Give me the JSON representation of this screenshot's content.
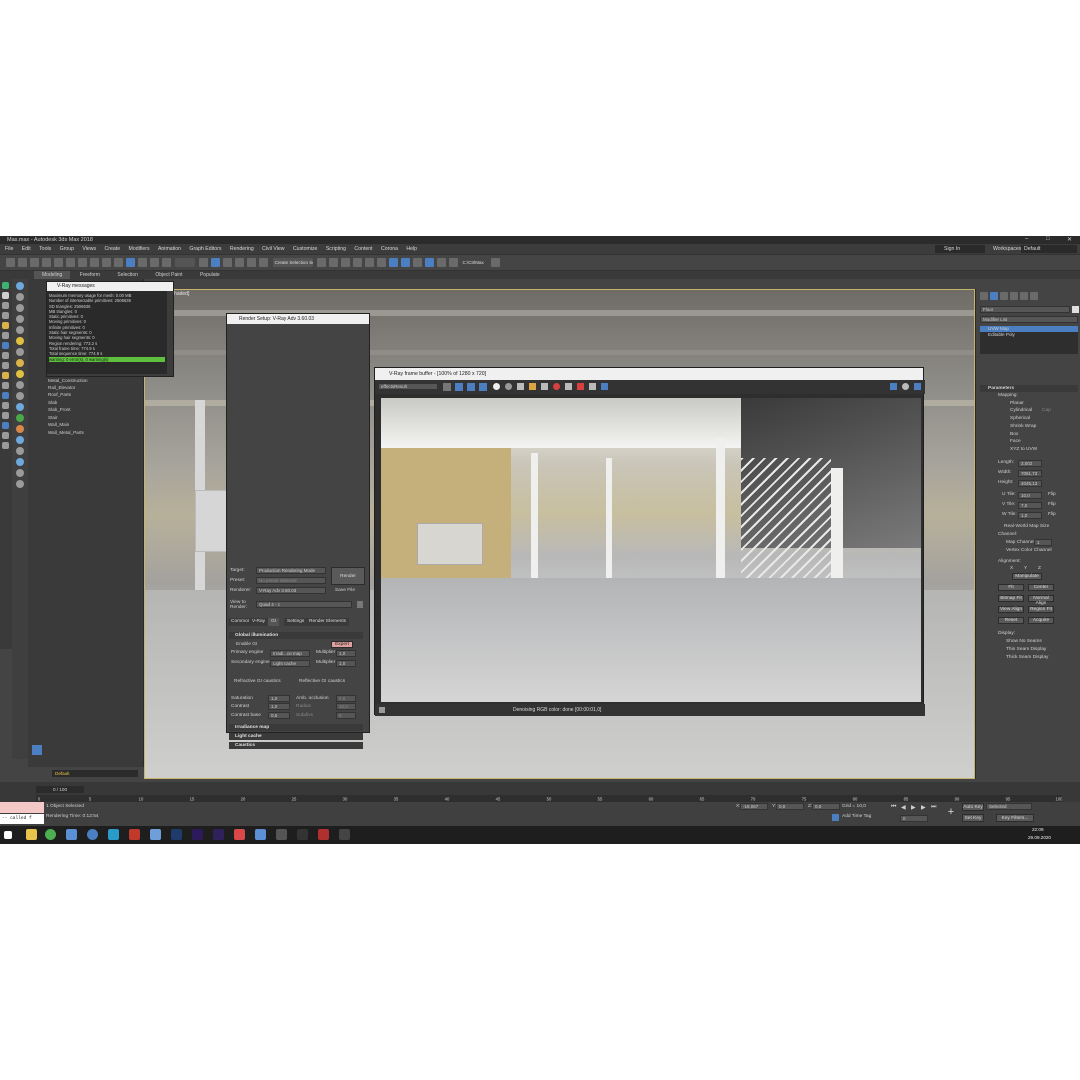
{
  "window": {
    "title": "Mas.max - Autodesk 3ds Max 2018"
  },
  "menu": [
    "File",
    "Edit",
    "Tools",
    "Group",
    "Views",
    "Create",
    "Modifiers",
    "Animation",
    "Graph Editors",
    "Rendering",
    "Civil View",
    "Customize",
    "Scripting",
    "Content",
    "Corona",
    "Help"
  ],
  "header": {
    "sign_in": "Sign In",
    "workspaces_label": "Workspaces:",
    "workspace": "Default",
    "selection_set": "Create Selection Se",
    "view_dropdown": "View",
    "ctrl_label": "C:\\CtrlMax"
  },
  "ribbon_tabs": [
    "Modeling",
    "Freeform",
    "Selection",
    "Object Paint",
    "Populate"
  ],
  "viewport": {
    "label": "[+] [Top] [Shaded]"
  },
  "vray_messages": {
    "title": "V-Ray messages",
    "lines": [
      "Maximum memory usage for mesh: 0.00 MB",
      "Number of intersectable primitives: 2506636",
      "SD triangles: 2506636",
      "MB triangles: 0",
      "Static primitives: 0",
      "Moving primitives: 0",
      "Infinite primitives: 0",
      "Static hair segments: 0",
      "Moving hair segments: 0",
      "Region rendering: 773.2 s",
      "Total frame time: 774.9 s",
      "Total sequence time: 774.9 s"
    ],
    "highlight": "warning: 0 error(s), 0 warning(s)"
  },
  "scene_explorer": {
    "items": [
      "Metal_Construction",
      "Rail_Elevator",
      "Roof_Parts",
      "Slab",
      "Slab_Front",
      "Stair",
      "Wall_Main",
      "Wall_Metal_Parts"
    ],
    "layer": "Default"
  },
  "render_setup": {
    "title": "Render Setup: V-Ray Adv 3.60.03",
    "target_label": "Target:",
    "target": "Production Rendering Mode",
    "preset_label": "Preset:",
    "preset": "No preset selected",
    "renderer_label": "Renderer:",
    "renderer": "V-Ray Adv 3.60.03",
    "save_file": "Save File",
    "view_label": "View to Render:",
    "view": "Quad 4 - c",
    "render_button": "Render",
    "tabs": [
      "Common",
      "V-Ray",
      "GI",
      "Settings",
      "Render Elements"
    ],
    "gi_section": "Global illumination",
    "enable_gi": "Enable GI",
    "expert": "Expert",
    "primary_label": "Primary engine",
    "primary": "Irradi...ce map",
    "secondary_label": "Secondary engine",
    "secondary": "Light cache",
    "multiplier_label": "Multiplier",
    "multiplier1": "1,0",
    "multiplier2": "1,0",
    "refractive": "Refractive GI caustics",
    "reflective": "Reflective GI caustics",
    "saturation_label": "Saturation",
    "saturation": "1,0",
    "contrast_label": "Contrast",
    "contrast": "1,0",
    "contrast_base_label": "Contrast base",
    "contrast_base": "0,5",
    "amb_occ": "Amb. occlusion",
    "amb_val": "0,8",
    "radius_label": "Radius",
    "radius_val": "10,0",
    "subdivs_label": "Subdivs",
    "subdivs_val": "8",
    "irradiance": "Irradiance map",
    "light_cache": "Light cache",
    "caustics": "Caustics"
  },
  "frame_buffer": {
    "title": "V-Ray frame buffer - [100% of 1280 x 720]",
    "channel": "effectsResult",
    "status": "Denoising RGB color: done [00:00:01,0]"
  },
  "command_panel": {
    "object_name": "Floor",
    "modifier_list": "Modifier List",
    "stack": [
      "UVW Map",
      "Editable Poly"
    ],
    "params_title": "Parameters",
    "mapping_label": "Mapping:",
    "mapping": [
      "Planar",
      "Cylindrical",
      "Spherical",
      "Shrink Wrap",
      "Box",
      "Face",
      "XYZ to UVW"
    ],
    "cap": "Cap",
    "length_label": "Length:",
    "length": "3,002",
    "width_label": "Width:",
    "width": "7061,73",
    "height_label": "Height:",
    "height": "4045,13",
    "utile_label": "U Tile:",
    "utile": "10,0",
    "vtile_label": "V Tile:",
    "vtile": "7,0",
    "wtile_label": "W Tile:",
    "wtile": "1,0",
    "flip": "Flip",
    "real_world": "Real-World Map Size",
    "channel_label": "Channel:",
    "map_channel": "Map Channel:",
    "map_channel_val": "1",
    "vertex_color": "Vertex Color Channel",
    "alignment_label": "Alignment:",
    "axes": [
      "X",
      "Y",
      "Z"
    ],
    "buttons": [
      "Manipulate",
      "Fit",
      "Center",
      "Bitmap Fit",
      "Normal Align",
      "View Align",
      "Region Fit",
      "Reset",
      "Acquire"
    ],
    "display_label": "Display:",
    "display": [
      "Show No Seams",
      "Thin Seam Display",
      "Thick Seam Display"
    ]
  },
  "timeline": {
    "frame": "0 / 100",
    "ticks": [
      "0",
      "5",
      "10",
      "15",
      "20",
      "25",
      "30",
      "35",
      "40",
      "45",
      "50",
      "55",
      "60",
      "65",
      "70",
      "75",
      "80",
      "85",
      "90",
      "95",
      "100"
    ]
  },
  "status": {
    "selected": "1 Object Selected",
    "render_time": "Rendering Time: 0:12:54",
    "script": "-- called f",
    "x_label": "X:",
    "x": "-18,067",
    "y_label": "Y:",
    "y": "0,0",
    "z_label": "Z:",
    "z": "0,0",
    "grid": "Grid = 10,0",
    "add_time_tag": "Add Time Tag",
    "auto_key": "Auto Key",
    "set_key": "Set Key",
    "selected_dd": "Selected",
    "key_filters": "Key Filters...",
    "frame_field": "0"
  },
  "taskbar": {
    "time": "22:09",
    "date": "29.09.2020"
  },
  "colors": {
    "accent": "#4b7fc1",
    "app_bg": "#444444",
    "viewport_border": "#c8b36a",
    "highlight": "#5fbf3f"
  }
}
